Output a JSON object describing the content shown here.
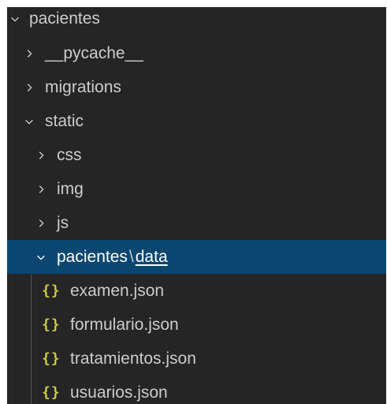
{
  "explorer": {
    "items": [
      {
        "label": "pacientes",
        "icon": "chevron-down-icon"
      },
      {
        "label": "__pycache__",
        "icon": "chevron-right-icon"
      },
      {
        "label": "migrations",
        "icon": "chevron-right-icon"
      },
      {
        "label": "static",
        "icon": "chevron-down-icon"
      },
      {
        "label": "css",
        "icon": "chevron-right-icon"
      },
      {
        "label": "img",
        "icon": "chevron-right-icon"
      },
      {
        "label": "js",
        "icon": "chevron-right-icon"
      },
      {
        "label_part1": "pacientes",
        "separator": "\\",
        "label_part2": "data",
        "icon": "chevron-down-icon",
        "selected": true
      },
      {
        "label": "examen.json",
        "icon": "json-braces-icon"
      },
      {
        "label": "formulario.json",
        "icon": "json-braces-icon"
      },
      {
        "label": "tratamientos.json",
        "icon": "json-braces-icon"
      },
      {
        "label": "usuarios.json",
        "icon": "json-braces-icon"
      }
    ],
    "json_icon_glyph": "{}"
  },
  "colors": {
    "background": "#252526",
    "selection": "#094771",
    "text": "#cccccc",
    "json_icon": "#cbcb41"
  }
}
